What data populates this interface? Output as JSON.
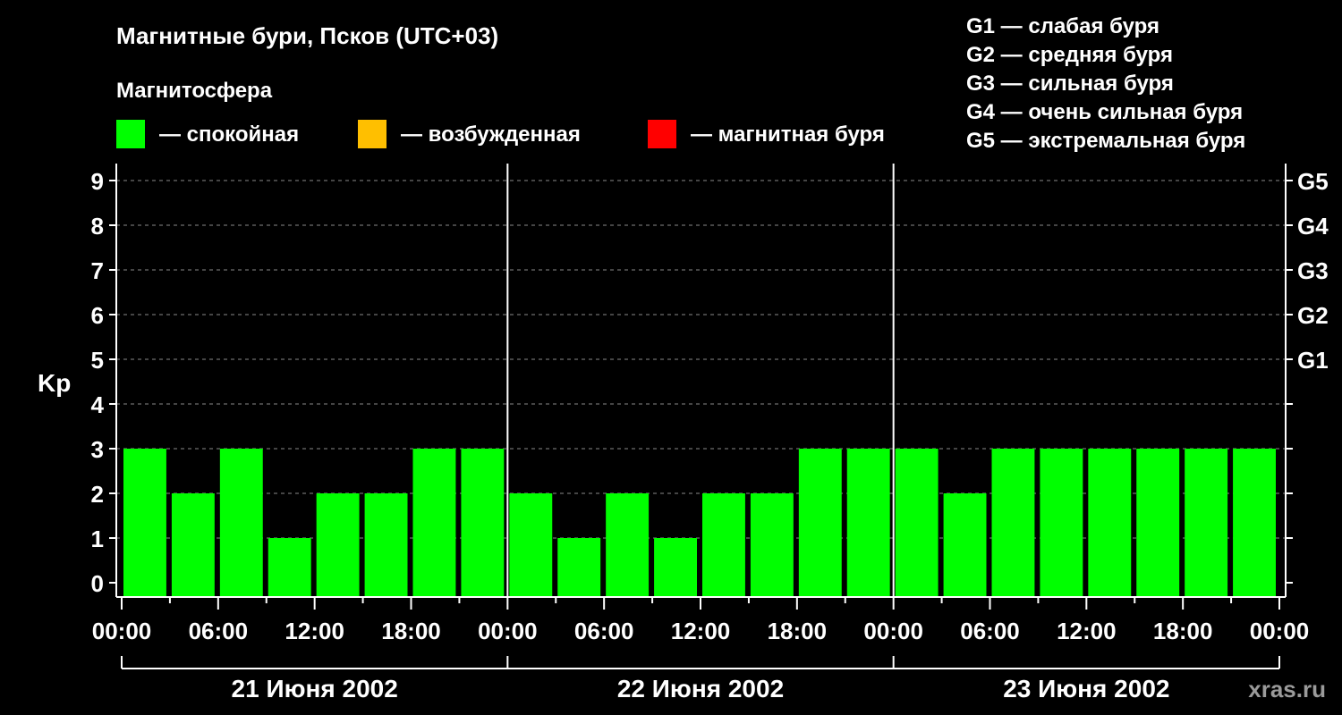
{
  "chart_data": {
    "type": "bar",
    "title": "Магнитные бури, Псков (UTC+03)",
    "legend_title": "Магнитосфера",
    "legend": [
      {
        "label": "— спокойная",
        "color": "#00ff00"
      },
      {
        "label": "— возбужденная",
        "color": "#ffbf00"
      },
      {
        "label": "— магнитная буря",
        "color": "#ff0000"
      }
    ],
    "storm_scale": [
      "G1 — слабая буря",
      "G2 — средняя буря",
      "G3 — сильная буря",
      "G4 — очень сильная буря",
      "G5 — экстремальная буря"
    ],
    "ylabel": "Kp",
    "ylim": [
      0,
      9
    ],
    "y_ticks": [
      "0",
      "1",
      "2",
      "3",
      "4",
      "5",
      "6",
      "7",
      "8",
      "9"
    ],
    "right_ticks": [
      {
        "value": 5,
        "label": "G1"
      },
      {
        "value": 6,
        "label": "G2"
      },
      {
        "value": 7,
        "label": "G3"
      },
      {
        "value": 8,
        "label": "G4"
      },
      {
        "value": 9,
        "label": "G5"
      }
    ],
    "x_ticks": [
      "00:00",
      "06:00",
      "12:00",
      "18:00",
      "00:00",
      "06:00",
      "12:00",
      "18:00",
      "00:00",
      "06:00",
      "12:00",
      "18:00",
      "00:00"
    ],
    "days": [
      "21 Июня 2002",
      "22 Июня 2002",
      "23 Июня 2002"
    ],
    "values": [
      3,
      2,
      3,
      1,
      2,
      2,
      3,
      3,
      2,
      1,
      2,
      1,
      2,
      2,
      3,
      3,
      3,
      2,
      3,
      3,
      3,
      3,
      3,
      3
    ],
    "bar_color": "#00ff00",
    "grid": "dashed horizontal",
    "watermark": "xras.ru"
  }
}
